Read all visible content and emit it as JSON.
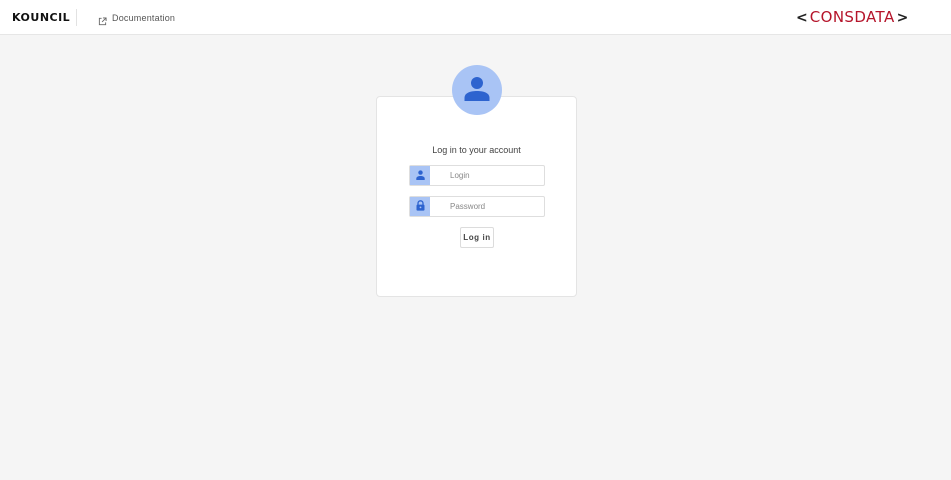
{
  "header": {
    "brand": "KOUNCIL",
    "doc_link_label": "Documentation",
    "logo_text": "CONSDATA",
    "logo_left": "<",
    "logo_right": ">"
  },
  "login": {
    "heading": "Log in to your account",
    "login_placeholder": "Login",
    "password_placeholder": "Password",
    "submit_label": "Log in"
  },
  "colors": {
    "accent": "#a9c4f5",
    "icon": "#2d63cf",
    "logo": "#b5152b"
  },
  "icons": {
    "doc": "external-link-icon",
    "avatar": "user-icon",
    "login_addon": "user-icon",
    "password_addon": "lock-icon"
  }
}
